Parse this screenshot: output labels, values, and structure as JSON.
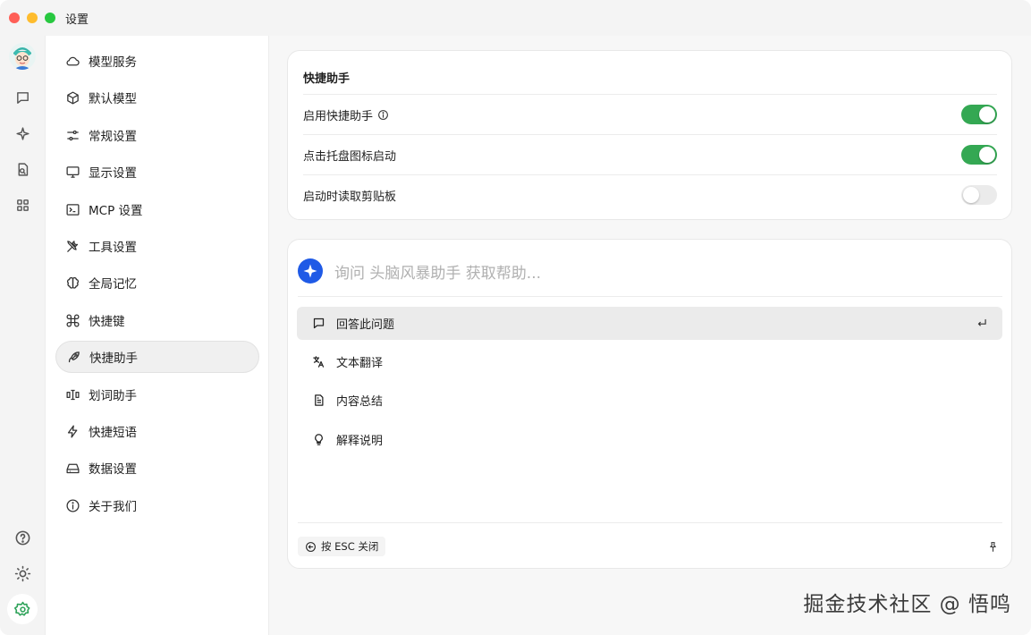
{
  "window": {
    "title": "设置"
  },
  "sidebar": {
    "items": [
      {
        "label": "模型服务",
        "icon": "cloud-icon"
      },
      {
        "label": "默认模型",
        "icon": "cube-icon"
      },
      {
        "label": "常规设置",
        "icon": "sliders-icon"
      },
      {
        "label": "显示设置",
        "icon": "monitor-icon"
      },
      {
        "label": "MCP 设置",
        "icon": "terminal-icon"
      },
      {
        "label": "工具设置",
        "icon": "tools-icon"
      },
      {
        "label": "全局记忆",
        "icon": "brain-icon"
      },
      {
        "label": "快捷键",
        "icon": "command-icon"
      },
      {
        "label": "快捷助手",
        "icon": "rocket-icon",
        "active": true
      },
      {
        "label": "划词助手",
        "icon": "text-cursor-icon"
      },
      {
        "label": "快捷短语",
        "icon": "zap-icon"
      },
      {
        "label": "数据设置",
        "icon": "drive-icon"
      },
      {
        "label": "关于我们",
        "icon": "info-icon"
      }
    ]
  },
  "settings_card": {
    "title": "快捷助手",
    "rows": [
      {
        "label": "启用快捷助手",
        "on": true
      },
      {
        "label": "点击托盘图标启动",
        "on": true
      },
      {
        "label": "启动时读取剪贴板",
        "on": false
      }
    ]
  },
  "preview": {
    "placeholder": "询问 头脑风暴助手 获取帮助...",
    "commands": [
      {
        "label": "回答此问题",
        "icon": "message-icon"
      },
      {
        "label": "文本翻译",
        "icon": "translate-icon"
      },
      {
        "label": "内容总结",
        "icon": "document-icon"
      },
      {
        "label": "解释说明",
        "icon": "lightbulb-icon"
      }
    ],
    "footer": "按 ESC 关闭"
  },
  "watermark": "掘金技术社区 @ 悟鸣",
  "colors": {
    "accent": "#34a853",
    "brand": "#1f5ae6"
  }
}
